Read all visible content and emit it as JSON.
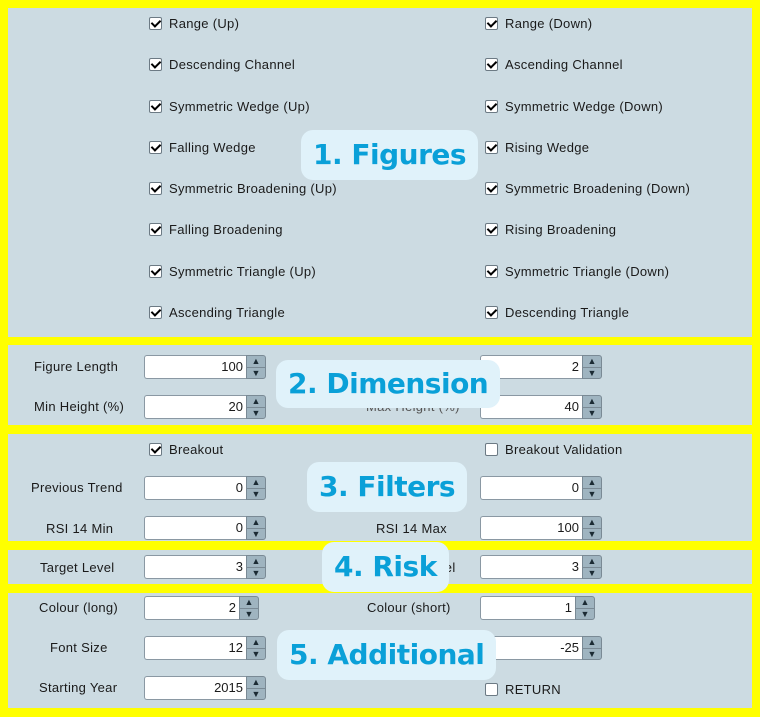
{
  "sections": {
    "figures": {
      "badge": "1. Figures",
      "left": [
        {
          "label": "Range (Up)",
          "checked": true
        },
        {
          "label": "Descending Channel",
          "checked": true
        },
        {
          "label": "Symmetric Wedge (Up)",
          "checked": true
        },
        {
          "label": "Falling Wedge",
          "checked": true
        },
        {
          "label": "Symmetric Broadening (Up)",
          "checked": true
        },
        {
          "label": "Falling Broadening",
          "checked": true
        },
        {
          "label": "Symmetric Triangle (Up)",
          "checked": true
        },
        {
          "label": "Ascending Triangle",
          "checked": true
        }
      ],
      "right": [
        {
          "label": "Range (Down)",
          "checked": true
        },
        {
          "label": "Ascending Channel",
          "checked": true
        },
        {
          "label": "Symmetric Wedge (Down)",
          "checked": true
        },
        {
          "label": "Rising Wedge",
          "checked": true
        },
        {
          "label": "Symmetric Broadening (Down)",
          "checked": true
        },
        {
          "label": "Rising Broadening",
          "checked": true
        },
        {
          "label": "Symmetric Triangle (Down)",
          "checked": true
        },
        {
          "label": "Descending Triangle",
          "checked": true
        }
      ]
    },
    "dimension": {
      "badge": "2. Dimension",
      "figure_length": {
        "label": "Figure Length",
        "value": "100"
      },
      "min_height": {
        "label": "Min Height (%)",
        "value": "20"
      },
      "right_top": {
        "label": "",
        "value": "2"
      },
      "max_height": {
        "label": "Max Height (%)",
        "value": "40"
      }
    },
    "filters": {
      "badge": "3. Filters",
      "breakout": {
        "label": "Breakout",
        "checked": true
      },
      "breakout_validation": {
        "label": "Breakout Validation",
        "checked": false
      },
      "previous_trend": {
        "label": "Previous Trend",
        "value": "0"
      },
      "right_mid": {
        "label": "",
        "value": "0"
      },
      "rsi_min": {
        "label": "RSI 14 Min",
        "value": "0"
      },
      "rsi_max": {
        "label": "RSI 14 Max",
        "value": "100"
      }
    },
    "risk": {
      "badge": "4. Risk",
      "target_level": {
        "label": "Target Level",
        "value": "3"
      },
      "right_level": {
        "label": "vel",
        "value": "3"
      }
    },
    "additional": {
      "badge": "5. Additional",
      "colour_long": {
        "label": "Colour (long)",
        "value": "2"
      },
      "colour_short": {
        "label": "Colour (short)",
        "value": "1"
      },
      "font_size": {
        "label": "Font Size",
        "value": "12"
      },
      "right_mid": {
        "label": "",
        "value": "-25"
      },
      "starting_year": {
        "label": "Starting Year",
        "value": "2015"
      },
      "return": {
        "label": "RETURN",
        "checked": false
      }
    }
  },
  "icons": {
    "up": "⌃",
    "down": "⌄"
  }
}
